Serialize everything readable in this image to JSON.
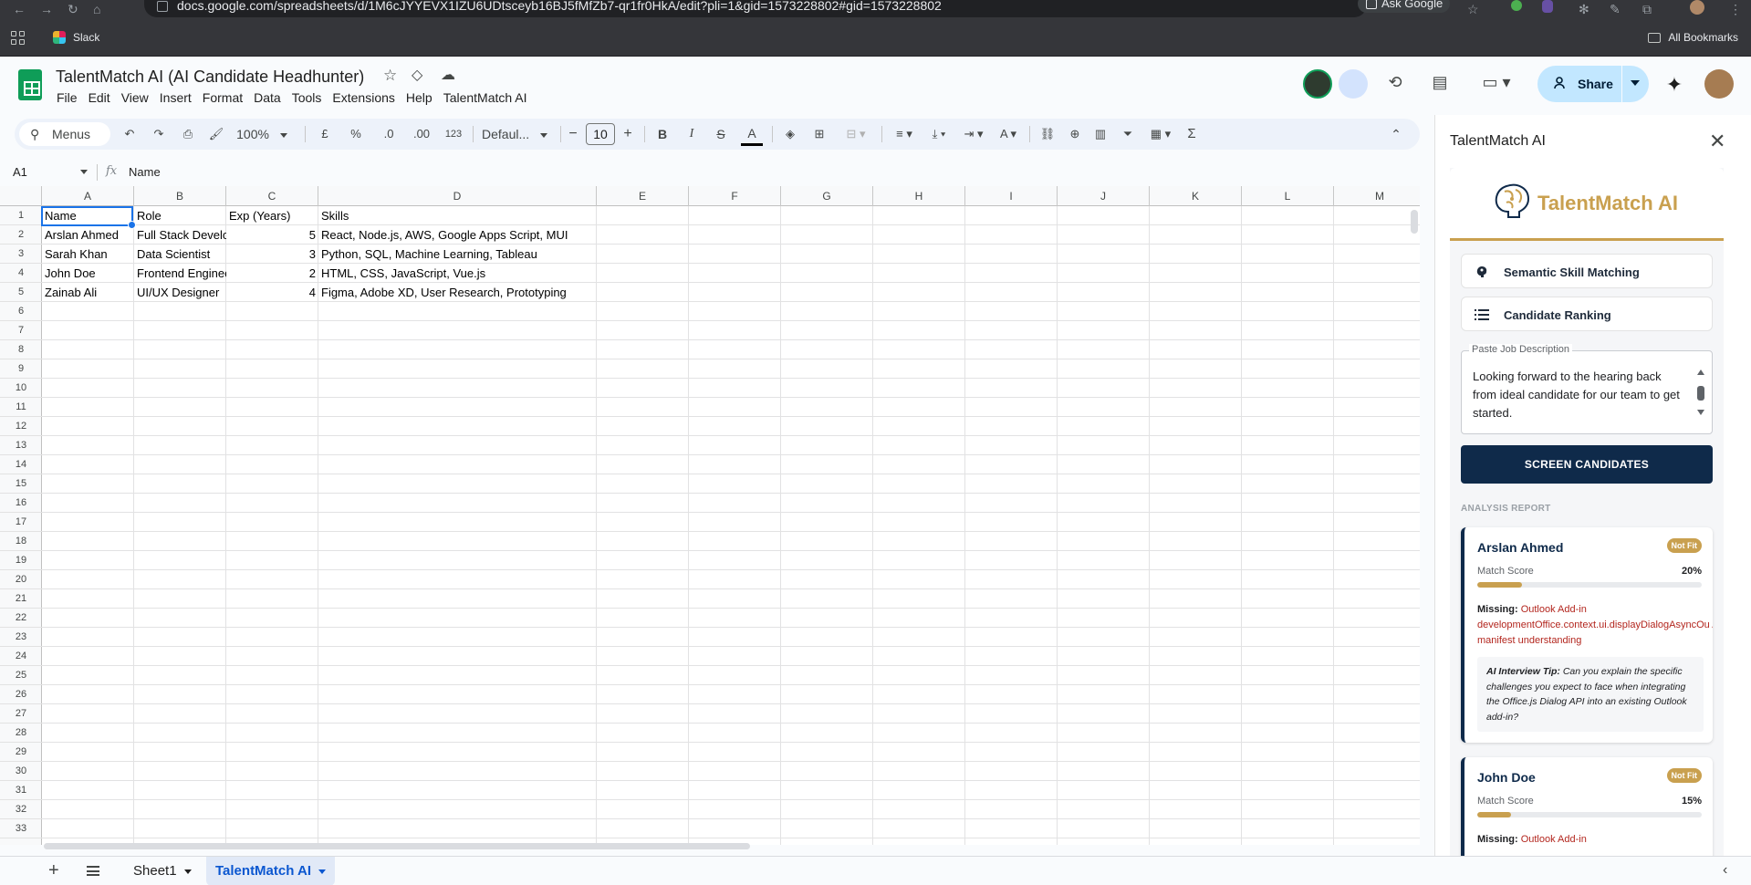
{
  "browser": {
    "url": "docs.google.com/spreadsheets/d/1M6cJYYEVX1IZU6UDtsceyb16BJ5fMfZb7-qr1fr0HkA/edit?pli=1&gid=1573228802#gid=1573228802",
    "ask_google": "Ask Google",
    "bookmark_slack": "Slack",
    "all_bookmarks": "All Bookmarks"
  },
  "doc": {
    "title": "TalentMatch AI (AI Candidate Headhunter)",
    "menu": [
      "File",
      "Edit",
      "View",
      "Insert",
      "Format",
      "Data",
      "Tools",
      "Extensions",
      "Help",
      "TalentMatch AI"
    ],
    "share_label": "Share"
  },
  "toolbar": {
    "menus_label": "Menus",
    "zoom": "100%",
    "currency": "£",
    "percent": "%",
    "dec_decrease": ".0",
    "dec_increase": ".00",
    "number_format": "123",
    "font": "Defaul...",
    "font_size": "10",
    "bold": "B",
    "italic": "I",
    "strike": "S",
    "text_color": "A",
    "sigma": "Σ"
  },
  "formula_bar": {
    "cell_ref": "A1",
    "fx": "fx",
    "value": "Name"
  },
  "sheet": {
    "columns": [
      "A",
      "B",
      "C",
      "D",
      "E",
      "F",
      "G",
      "H",
      "I",
      "J",
      "K",
      "L",
      "M"
    ],
    "rows": [
      "1",
      "2",
      "3",
      "4",
      "5",
      "6",
      "7",
      "8",
      "9",
      "10",
      "11",
      "12",
      "13",
      "14",
      "15",
      "16",
      "17",
      "18",
      "19",
      "20",
      "21",
      "22",
      "23",
      "24",
      "25",
      "26",
      "27",
      "28",
      "29",
      "30",
      "31",
      "32",
      "33"
    ],
    "headers": [
      "Name",
      "Role",
      "Exp (Years)",
      "Skills"
    ],
    "data": [
      [
        "Arslan Ahmed",
        "Full Stack Developer",
        "5",
        "React, Node.js, AWS, Google Apps Script, MUI"
      ],
      [
        "Sarah Khan",
        "Data Scientist",
        "3",
        "Python, SQL, Machine Learning, Tableau"
      ],
      [
        "John Doe",
        "Frontend Engineer",
        "2",
        "HTML, CSS, JavaScript, Vue.js"
      ],
      [
        "Zainab Ali",
        "UI/UX Designer",
        "4",
        "Figma, Adobe XD, User Research, Prototyping"
      ]
    ]
  },
  "tabs": [
    "Sheet1",
    "TalentMatch AI"
  ],
  "panel": {
    "title": "TalentMatch AI",
    "logo_text": "TalentMatch AI",
    "feature_1": "Semantic Skill Matching",
    "feature_2": "Candidate Ranking",
    "jd_label": "Paste Job Description",
    "jd_text": "Looking forward to the hearing back from ideal candidate for our team to get started.",
    "screen_button": "SCREEN CANDIDATES",
    "analysis_label": "ANALYSIS REPORT",
    "cards": [
      {
        "name": "Arslan Ahmed",
        "badge": "Not Fit",
        "score_label": "Match Score",
        "score": "20%",
        "score_value": 0.2,
        "missing_label": "Missing:",
        "missing": "Outlook Add-in developmentOffice.context.ui.displayDialogAsyncOu Add-in manifest understanding",
        "tip_label": "AI Interview Tip:",
        "tip": "Can you explain the specific challenges you expect to face when integrating the Office.js Dialog API into an existing Outlook add-in?"
      },
      {
        "name": "John Doe",
        "badge": "Not Fit",
        "score_label": "Match Score",
        "score": "15%",
        "score_value": 0.15,
        "missing_label": "Missing:",
        "missing": "Outlook Add-in"
      }
    ]
  },
  "colors": {
    "accent_navy": "#0f2a4a",
    "accent_gold": "#c9a04f",
    "share_bg": "#c2e7ff",
    "selection": "#1a73e8"
  }
}
